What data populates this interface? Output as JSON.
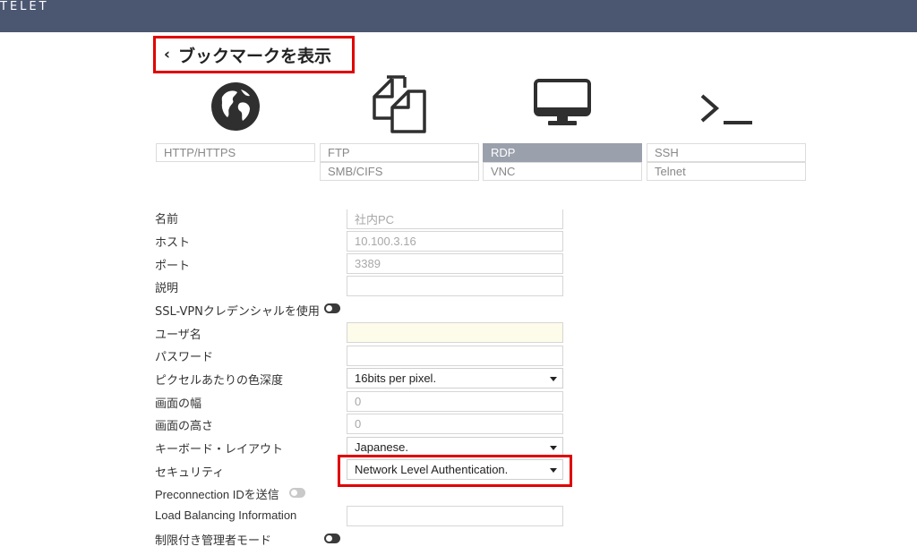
{
  "header": {
    "brand": "TELET"
  },
  "back": {
    "chevron": "‹",
    "label": "ブックマークを表示"
  },
  "type_icons": [
    "globe-icon",
    "copy-files-icon",
    "monitor-icon",
    "terminal-icon"
  ],
  "types": {
    "http": "HTTP/HTTPS",
    "ftp": "FTP",
    "smb": "SMB/CIFS",
    "rdp": "RDP",
    "vnc": "VNC",
    "ssh": "SSH",
    "telnet": "Telnet"
  },
  "form": {
    "name_label": "名前",
    "name_value": "社内PC",
    "host_label": "ホスト",
    "host_value": "10.100.3.16",
    "port_label": "ポート",
    "port_value": "3389",
    "desc_label": "説明",
    "desc_value": "",
    "sslvpn_label": "SSL-VPNクレデンシャルを使用",
    "sslvpn_toggle": "on",
    "user_label": "ユーザ名",
    "user_value": "",
    "pass_label": "パスワード",
    "pass_value": "",
    "color_label": "ピクセルあたりの色深度",
    "color_value": "16bits per pixel.",
    "width_label": "画面の幅",
    "width_value": "0",
    "height_label": "画面の高さ",
    "height_value": "0",
    "keyboard_label": "キーボード・レイアウト",
    "keyboard_value": "Japanese.",
    "security_label": "セキュリティ",
    "security_value": "Network Level Authentication.",
    "preconn_label": "Preconnection IDを送信",
    "preconn_toggle": "off",
    "lb_label": "Load Balancing Information",
    "lb_value": "",
    "restricted_label": "制限付き管理者モード",
    "restricted_toggle": "on"
  },
  "colors": {
    "header_bg": "#4b5671",
    "selected_tab": "#9aa0ac",
    "highlight": "#e00000"
  }
}
